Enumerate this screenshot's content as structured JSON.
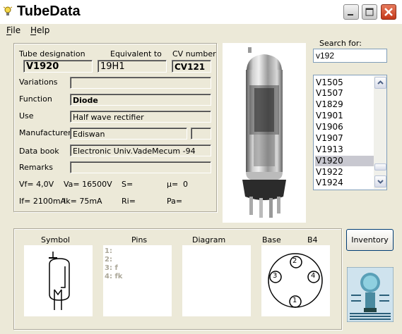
{
  "window": {
    "title": "TubeData"
  },
  "menu": {
    "file": "File",
    "help": "Help"
  },
  "info": {
    "designation_label": "Tube designation",
    "designation": "V1920",
    "equivalent_label": "Equivalent to",
    "equivalent": "19H1",
    "cv_label": "CV number",
    "cv": "CV121",
    "variations_label": "Variations",
    "variations": "",
    "function_label": "Function",
    "function": "Diode",
    "use_label": "Use",
    "use": "Half wave rectifier",
    "manufacturer_label": "Manufacturer",
    "manufacturer": "Ediswan",
    "manufacturer_extra": "",
    "databook_label": "Data book",
    "databook": "Electronic Univ.VadeMecum -94",
    "remarks_label": "Remarks",
    "remarks": ""
  },
  "params": {
    "vf": "Vf= 4,0V",
    "va": "Va= 16500V",
    "s": "S=",
    "mu": "µ=",
    "mu_val": "0",
    "if": "If= 2100mA",
    "ik": "Ik= 75mA",
    "ri": "Ri=",
    "pa": "Pa="
  },
  "search": {
    "label": "Search for:",
    "value": "v192"
  },
  "tube_list": [
    "V1505",
    "V1507",
    "V1829",
    "V1901",
    "V1906",
    "V1907",
    "V1913",
    "V1920",
    "V1922",
    "V1924"
  ],
  "selected_tube": "V1920",
  "bottom": {
    "symbol_label": "Symbol",
    "pins_label": "Pins",
    "diagram_label": "Diagram",
    "base_label": "Base",
    "base_type": "B4",
    "pins": [
      "1:",
      "2:",
      "3: f",
      "4: fk"
    ],
    "base_pin_numbers": [
      "1",
      "2",
      "3",
      "4"
    ]
  },
  "inventory_label": "Inventory",
  "colors": {
    "close": "#c4381a",
    "selection": "#c8c8d0",
    "list_border": "#7f9db9"
  }
}
